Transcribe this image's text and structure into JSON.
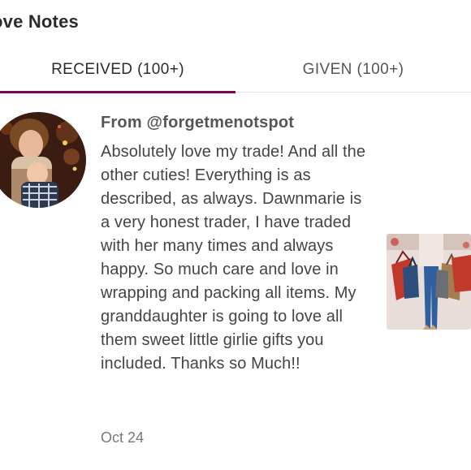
{
  "header": {
    "title": "ove Notes"
  },
  "tabs": [
    {
      "label": "RECEIVED (100+)"
    },
    {
      "label": "GIVEN (100+)"
    }
  ],
  "note": {
    "from": "From @forgetmenotspot",
    "body": "Absolutely love my trade! And all the other cuties! Everything is as described, as always. Dawnmarie is a very honest trader, I have traded with her many times and always happy. So much care and love in wrapping and packing all items. My granddaughter is going to love all them sweet little girlie gifts you included. Thanks so Much!!",
    "date": "Oct 24"
  },
  "colors": {
    "accent": "#7f0353",
    "divider": "#e4e4e4"
  }
}
